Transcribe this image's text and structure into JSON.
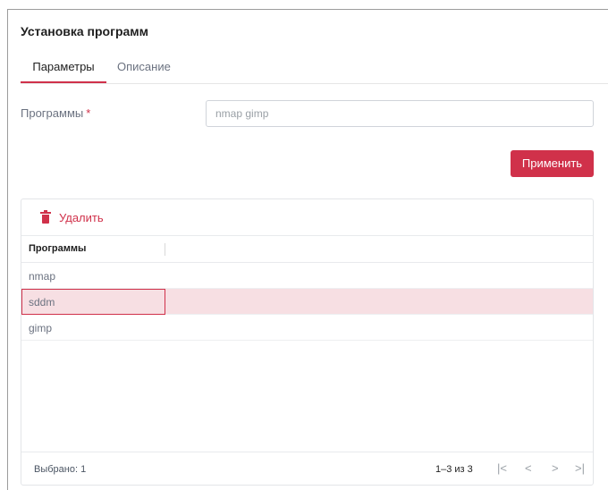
{
  "title": "Установка программ",
  "tabs": [
    {
      "label": "Параметры",
      "active": true
    },
    {
      "label": "Описание",
      "active": false
    }
  ],
  "form": {
    "programs_label": "Программы",
    "required_mark": "*",
    "programs_value": "nmap gimp"
  },
  "apply_label": "Применить",
  "table": {
    "delete_label": "Удалить",
    "column_header": "Программы",
    "rows": [
      "nmap",
      "sddm",
      "gimp"
    ],
    "selected_row": 1
  },
  "footer": {
    "selected_text": "Выбрано: 1",
    "range_text": "1–3 из 3",
    "pager": {
      "first": "|<",
      "prev": "<",
      "next": ">",
      "last": ">|"
    }
  },
  "colors": {
    "accent": "#d0314a",
    "selected_row_bg": "#f7dfe3"
  },
  "icons": {
    "delete": "trash-icon"
  }
}
